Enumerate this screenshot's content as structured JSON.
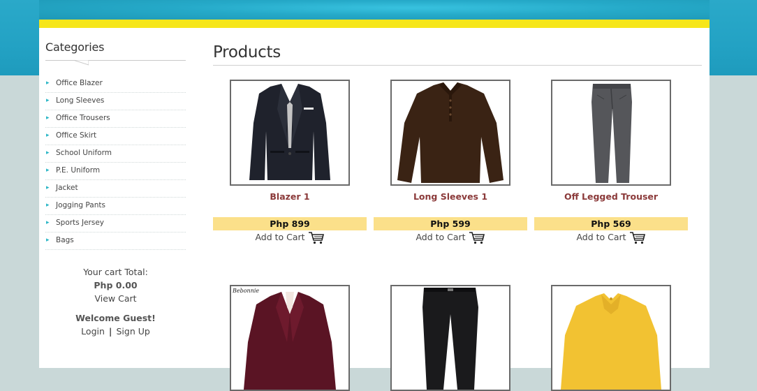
{
  "sidebar": {
    "categories_title": "Categories",
    "categories": [
      "Office Blazer",
      "Long Sleeves",
      "Office Trousers",
      "Office Skirt",
      "School Uniform",
      "P.E. Uniform",
      "Jacket",
      "Jogging Pants",
      "Sports Jersey",
      "Bags"
    ],
    "cart_total_label": "Your cart Total:",
    "cart_total_value": "Php 0.00",
    "view_cart_label": "View Cart",
    "welcome_text": "Welcome Guest!",
    "login_label": "Login",
    "separator": "|",
    "signup_label": "Sign Up"
  },
  "main": {
    "title": "Products",
    "add_to_cart_label": "Add to Cart",
    "products": [
      {
        "name": "Blazer 1",
        "price": "Php 899",
        "image": "black-blazer"
      },
      {
        "name": "Long Sleeves 1",
        "price": "Php 599",
        "image": "brown-long-sleeve-polo"
      },
      {
        "name": "Off Legged Trouser",
        "price": "Php 569",
        "image": "gray-trousers"
      },
      {
        "name": "",
        "price": "",
        "image": "maroon-blazer",
        "watermark": "Bebonnie"
      },
      {
        "name": "",
        "price": "",
        "image": "black-trousers"
      },
      {
        "name": "",
        "price": "",
        "image": "yellow-blouse"
      }
    ]
  },
  "colors": {
    "header_blue": "#23a2c4",
    "accent_yellow": "#f6e61a",
    "price_bg": "#fbe08a",
    "product_name": "#8b3a3a",
    "arrow_teal": "#2bb6c6",
    "page_bg": "#c9d8d8"
  }
}
